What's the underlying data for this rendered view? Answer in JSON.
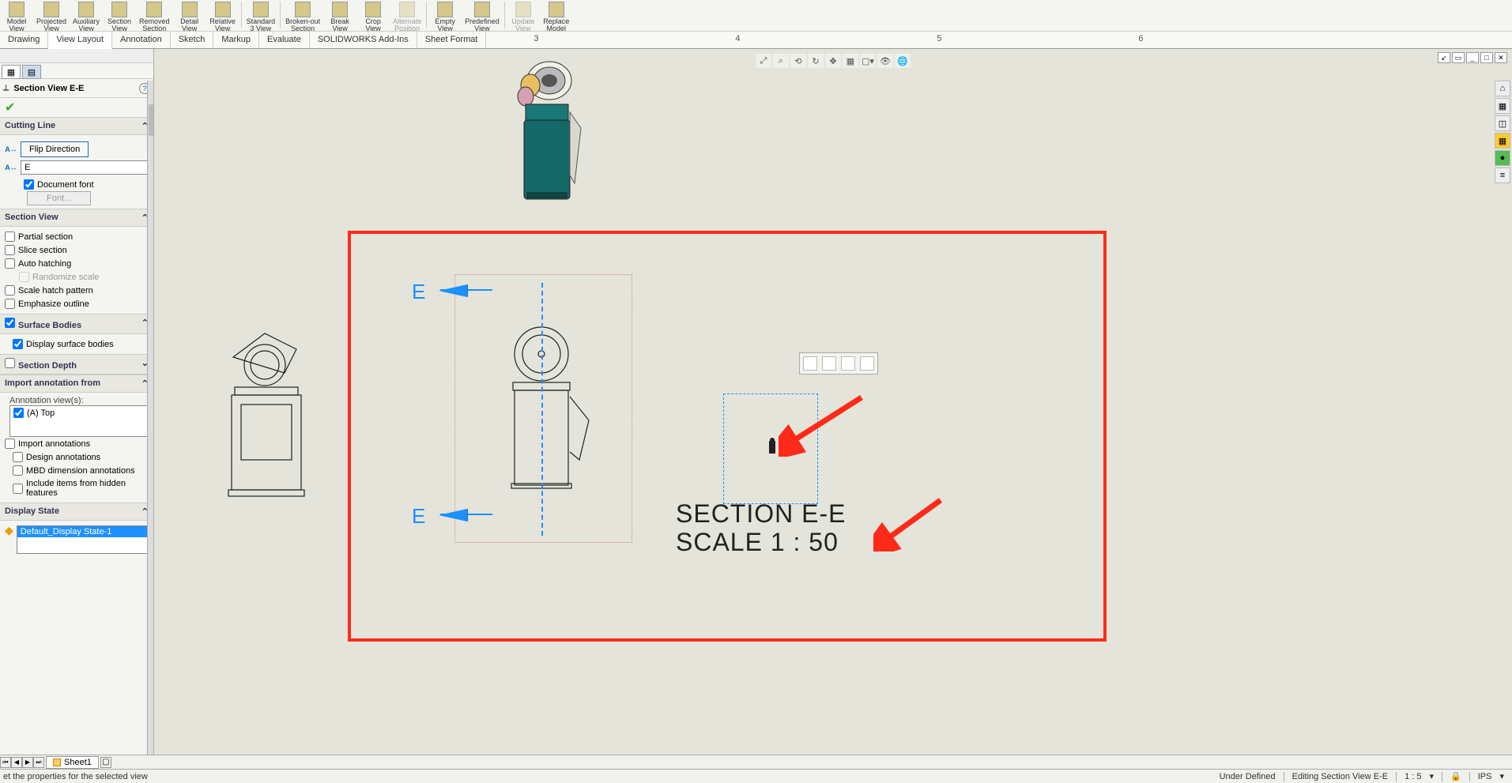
{
  "ribbon": {
    "items": [
      {
        "label": "Model\nView"
      },
      {
        "label": "Projected\nView"
      },
      {
        "label": "Auxiliary\nView"
      },
      {
        "label": "Section\nView"
      },
      {
        "label": "Removed\nSection"
      },
      {
        "label": "Detail\nView"
      },
      {
        "label": "Relative\nView"
      },
      {
        "label": "Standard\n3 View"
      },
      {
        "label": "Broken-out\nSection"
      },
      {
        "label": "Break\nView"
      },
      {
        "label": "Crop\nView"
      },
      {
        "label": "Alternate\nPosition\nView",
        "disabled": true
      },
      {
        "label": "Empty\nView"
      },
      {
        "label": "Predefined\nView"
      },
      {
        "label": "Update\nView",
        "disabled": true
      },
      {
        "label": "Replace\nModel"
      }
    ]
  },
  "tabs": [
    "Drawing",
    "View Layout",
    "Annotation",
    "Sketch",
    "Markup",
    "Evaluate",
    "SOLIDWORKS Add-Ins",
    "Sheet Format"
  ],
  "ruler_marks": [
    "3",
    "4",
    "5",
    "6"
  ],
  "panel": {
    "title": "Section View E-E",
    "sections": {
      "cutting_line": {
        "head": "Cutting Line",
        "flip": "Flip Direction",
        "letter": "E",
        "doc_font": "Document font",
        "font_btn": "Font..."
      },
      "section_view": {
        "head": "Section View",
        "partial": "Partial section",
        "slice": "Slice section",
        "auto_hatch": "Auto hatching",
        "randomize": "Randomize scale",
        "scale_hatch": "Scale hatch pattern",
        "emphasize": "Emphasize outline"
      },
      "surface_bodies": {
        "head": "Surface Bodies",
        "display": "Display surface bodies"
      },
      "section_depth": {
        "head": "Section Depth"
      },
      "import_anno": {
        "head": "Import annotation from",
        "views_label": "Annotation view(s):",
        "view_item": "(A) Top",
        "import_anno": "Import annotations",
        "design_anno": "Design annotations",
        "mbd": "MBD dimension annotations",
        "include": "Include items from hidden features"
      },
      "display_state": {
        "head": "Display State",
        "item": "Default_Display State-1"
      }
    }
  },
  "annotations": {
    "section_letter_top": "E",
    "section_letter_bot": "E",
    "section_title": "SECTION E-E",
    "section_scale": "SCALE 1 : 50"
  },
  "sheet": {
    "name": "Sheet1"
  },
  "status": {
    "hint": "et the properties for the selected view",
    "under_defined": "Under Defined",
    "editing": "Editing Section View E-E",
    "scale": "1 : 5",
    "units": "IPS"
  }
}
